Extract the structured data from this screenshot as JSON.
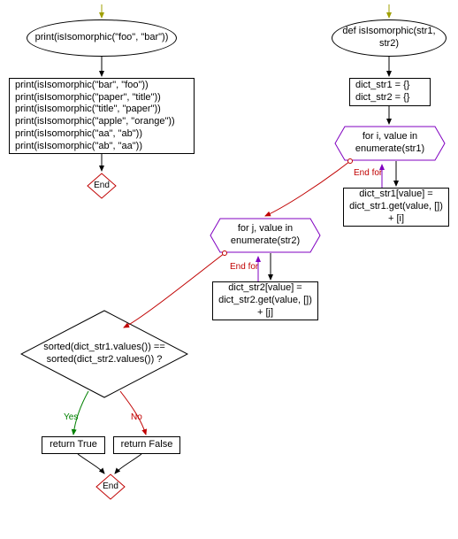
{
  "nodes": {
    "start1": "print(isIsomorphic(\"foo\", \"bar\"))",
    "start2_def": "def isIsomorphic(str1, str2)",
    "left_block": "print(isIsomorphic(\"bar\", \"foo\"))\nprint(isIsomorphic(\"paper\", \"title\"))\nprint(isIsomorphic(\"title\", \"paper\"))\nprint(isIsomorphic(\"apple\", \"orange\"))\nprint(isIsomorphic(\"aa\", \"ab\"))\nprint(isIsomorphic(\"ab\", \"aa\"))",
    "end_left": "End",
    "init_dicts": "dict_str1 = {}\ndict_str2 = {}",
    "for1": "for i, value in enumerate(str1)",
    "for1_body": "dict_str1[value] = dict_str1.get(value, []) + [i]",
    "for2": "for j, value in enumerate(str2)",
    "for2_body": "dict_str2[value] = dict_str2.get(value, []) + [j]",
    "decision": "sorted(dict_str1.values()) == sorted(dict_str2.values()) ?",
    "return_true": "return True",
    "return_false": "return False",
    "end_right": "End",
    "end_for1": "End for",
    "end_for2": "End for",
    "yes": "Yes",
    "no": "No"
  },
  "colors": {
    "hex_border": "#8000c0",
    "end_border": "#c00000",
    "yes": "#008000",
    "no": "#c00000",
    "arrow_green": "#a0a000",
    "arrow_red": "#c00000",
    "arrow_black": "#000",
    "arrow_purple": "#8000c0"
  }
}
